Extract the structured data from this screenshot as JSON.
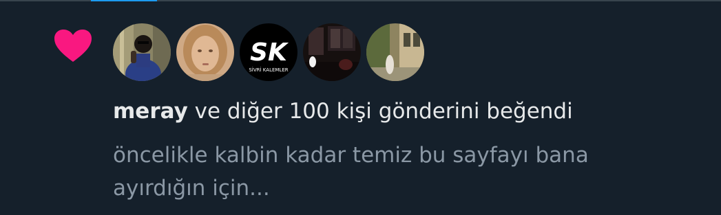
{
  "notification": {
    "type_icon": "heart-icon",
    "heart_color": "#f91880",
    "liker_name": "meray",
    "like_rest": " ve diğer 100 kişi gönderini beğendi",
    "preview_text": "öncelikle kalbin kadar temiz bu sayfayı bana ayırdığın için..."
  },
  "avatars": [
    {
      "icon": "avatar-photo-child"
    },
    {
      "icon": "avatar-photo-woman"
    },
    {
      "icon": "avatar-logo-sk",
      "logo_main": "SK",
      "logo_sub": "SİVRİ KALEMLER"
    },
    {
      "icon": "avatar-photo-dark-room"
    },
    {
      "icon": "avatar-photo-street"
    }
  ],
  "colors": {
    "background": "#15202b",
    "primary_text": "#e7e9ea",
    "secondary_text": "#8b98a5",
    "accent": "#1d9bf0"
  }
}
